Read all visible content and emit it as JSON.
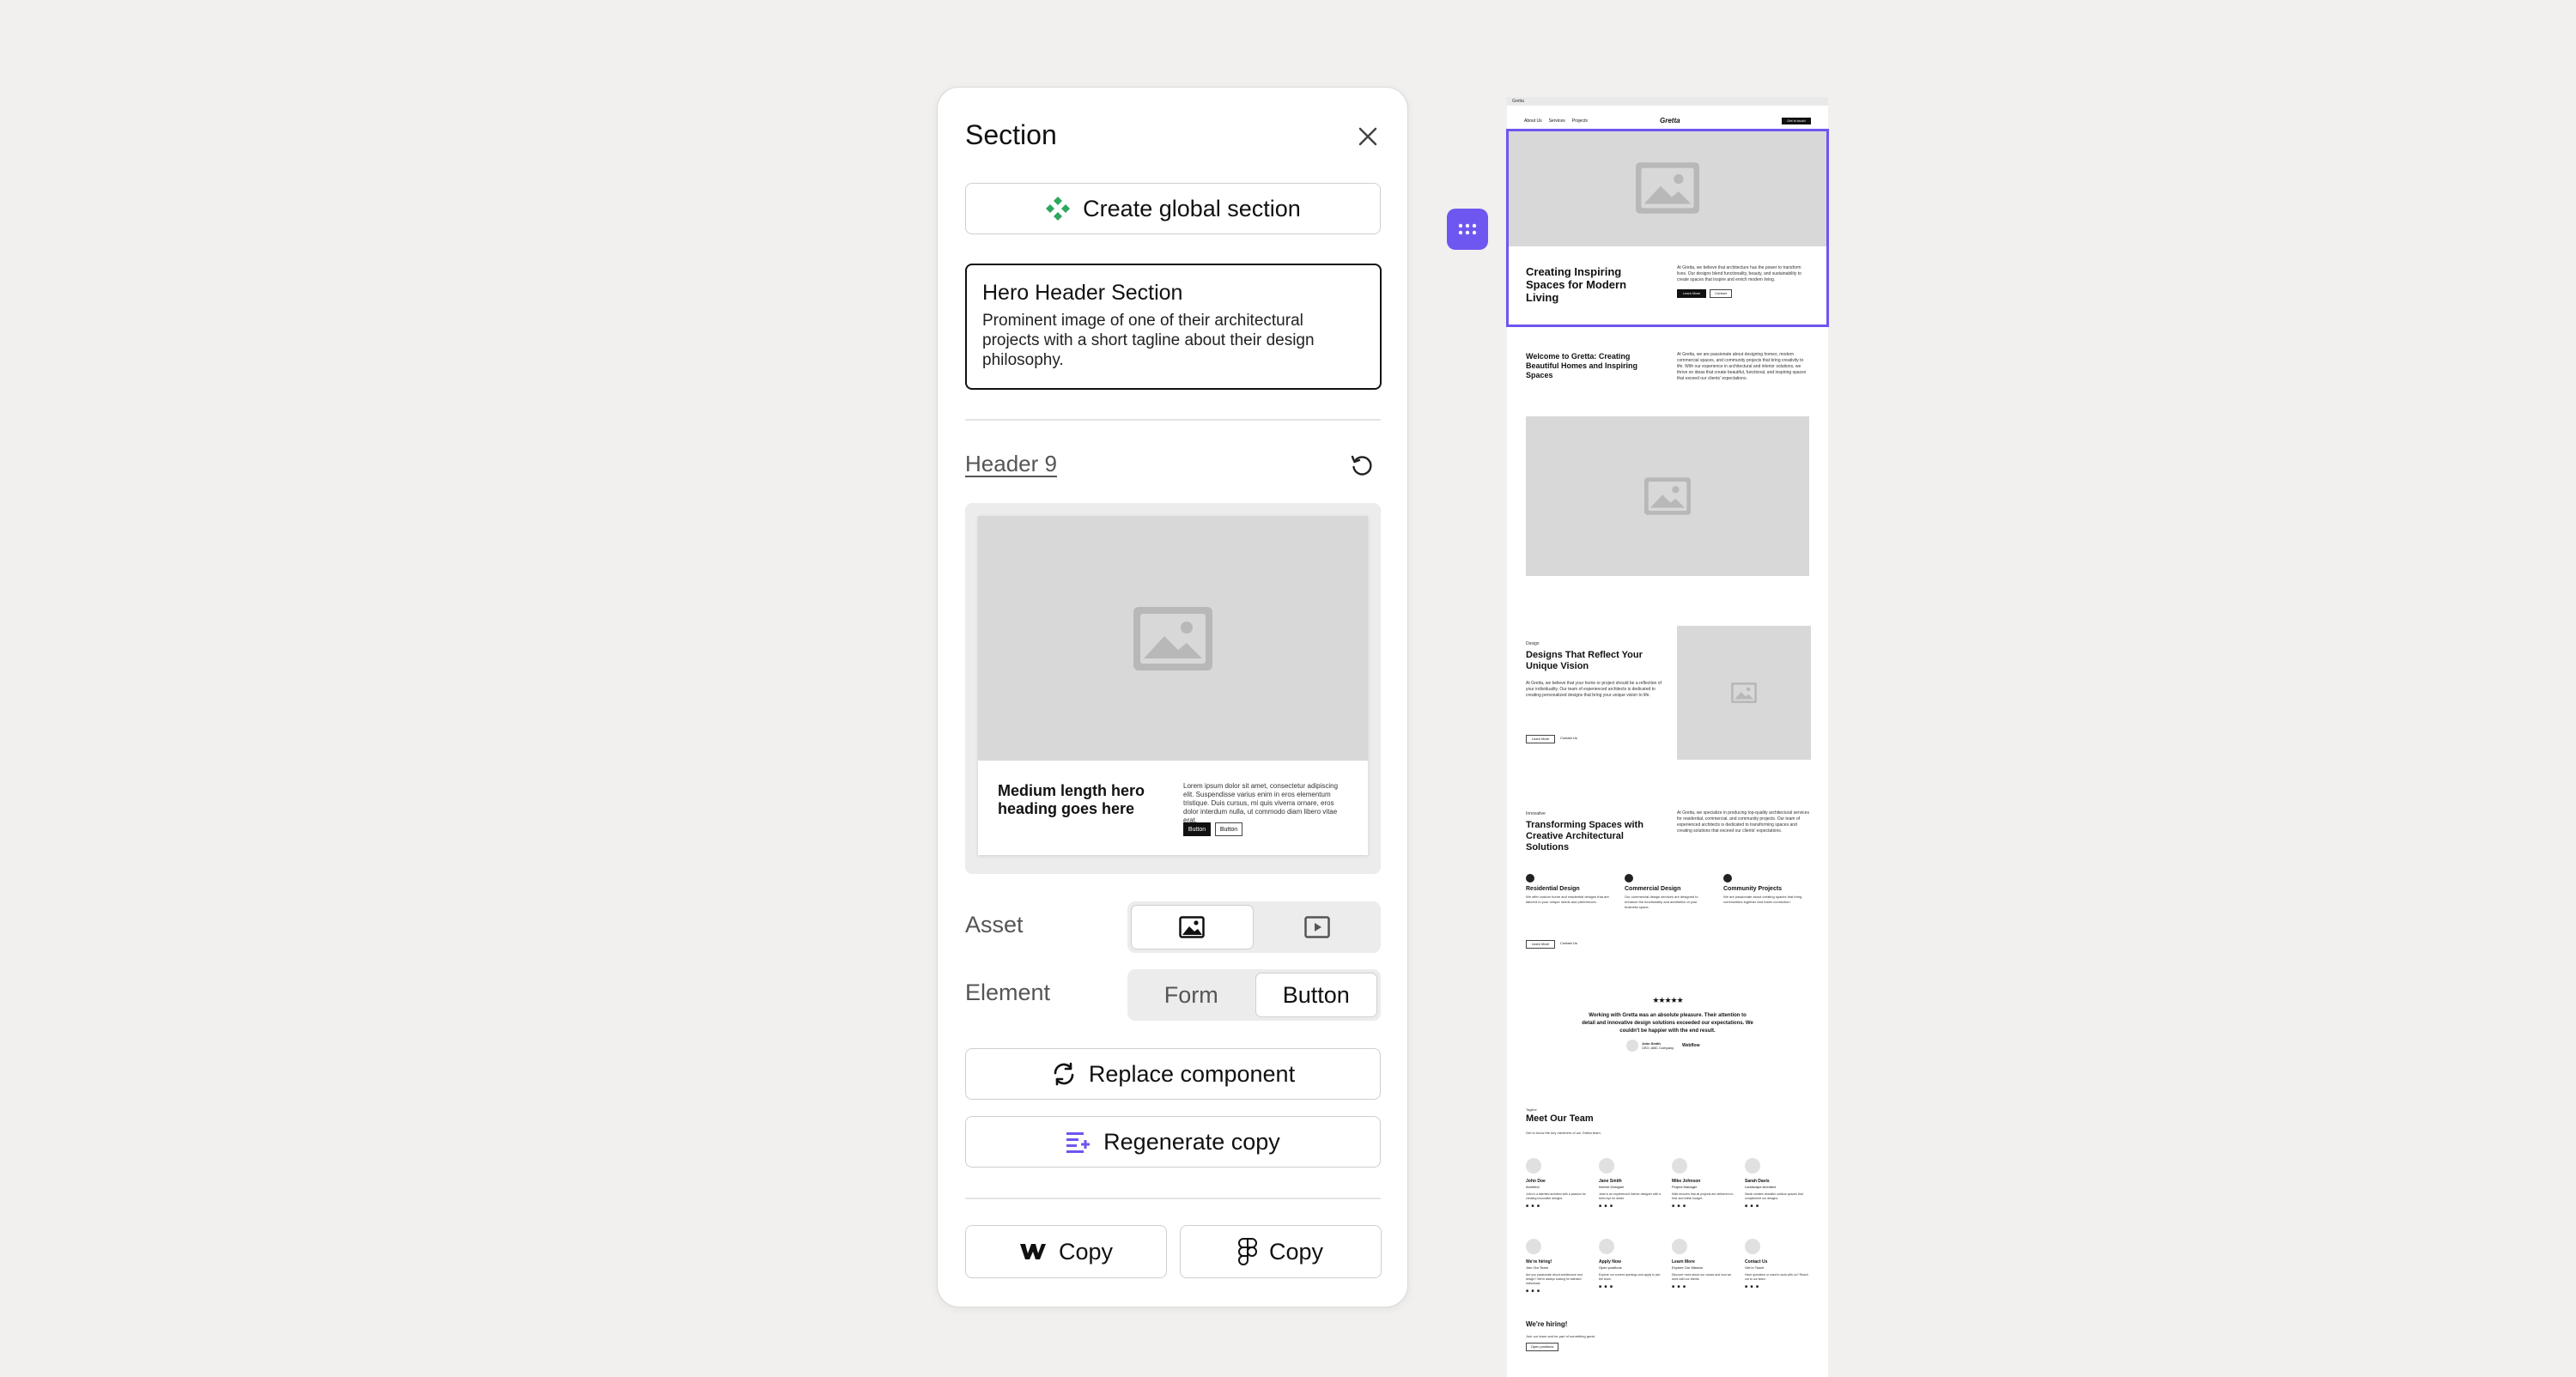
{
  "panel": {
    "title": "Section",
    "global_button_label": "Create global section",
    "section_name": "Hero Header Section",
    "section_description": "Prominent image of one of their architectural projects with a short tagline about their design philosophy.",
    "component_name": "Header 9",
    "preview": {
      "heading": "Medium length hero heading goes here",
      "paragraph": "Lorem ipsum dolor sit amet, consectetur adipiscing elit. Suspendisse varius enim in eros elementum tristique. Duis cursus, mi quis viverra ornare, eros dolor interdum nulla, ut commodo diam libero vitae erat.",
      "primary_button": "Button",
      "secondary_button": "Button"
    },
    "asset_label": "Asset",
    "element_label": "Element",
    "element_options": [
      "Form",
      "Button"
    ],
    "replace_label": "Replace component",
    "regenerate_label": "Regenerate copy",
    "copy_webflow_label": "Copy",
    "copy_figma_label": "Copy"
  },
  "site": {
    "browser_tab": "Gretta",
    "logo": "Gretta",
    "nav": [
      "About Us",
      "Services",
      "Projects"
    ],
    "nav_cta": "Get in touch",
    "hero": {
      "heading": "Creating Inspiring Spaces for Modern Living",
      "text": "At Gretta, we believe that architecture has the power to transform lives. Our designs blend functionality, beauty, and sustainability to create spaces that inspire and enrich modern living.",
      "primary": "Learn More",
      "secondary": "Contact"
    },
    "welcome": {
      "heading": "Welcome to Gretta: Creating Beautiful Homes and Inspiring Spaces",
      "text": "At Gretta, we are passionate about designing homes, modern commercial spaces, and community projects that bring creativity to life. With our experience in architectural and interior solutions, we thrive on ideas that create beautiful, functional, and inspiring spaces that exceed our clients' expectations."
    },
    "vision": {
      "tag": "Design",
      "heading": "Designs That Reflect Your Unique Vision",
      "text": "At Gretta, we believe that your home or project should be a reflection of your individuality. Our team of experienced architects is dedicated to creating personalized designs that bring your unique vision to life.",
      "primary": "Learn More",
      "secondary": "Contact Us"
    },
    "transform": {
      "tag": "Innovative",
      "heading": "Transforming Spaces with Creative Architectural Solutions",
      "text": "At Gretta, we specialize in producing top-quality architectural services for residential, commercial, and community projects. Our team of experienced architects is dedicated to transforming spaces and creating solutions that exceed our clients' expectations.",
      "features": [
        {
          "title": "Residential Design",
          "text": "We offer custom home and residential designs that are tailored to your unique needs and preferences."
        },
        {
          "title": "Commercial Design",
          "text": "Our commercial design services are designed to enhance the functionality and aesthetics of your business space."
        },
        {
          "title": "Community Projects",
          "text": "We are passionate about creating spaces that bring communities together and foster connection."
        }
      ],
      "primary": "Learn More",
      "secondary": "Contact Us"
    },
    "testimonial": {
      "stars": "★★★★★",
      "quote": "Working with Gretta was an absolute pleasure. Their attention to detail and innovative design solutions exceeded our expectations. We couldn't be happier with the end result.",
      "name": "John Smith",
      "role": "CEO, ABC Company",
      "company": "Webflow"
    },
    "team": {
      "tag": "Tagline",
      "heading": "Meet Our Team",
      "subheading": "Get to know the key members of our Gretta team.",
      "members": [
        {
          "name": "John Doe",
          "role": "Architect",
          "bio": "John is a talented architect with a passion for creating innovative designs."
        },
        {
          "name": "Jane Smith",
          "role": "Interior Designer",
          "bio": "Jane is an experienced interior designer with a keen eye for detail."
        },
        {
          "name": "Mike Johnson",
          "role": "Project Manager",
          "bio": "Mike ensures that all projects are delivered on time and within budget."
        },
        {
          "name": "Sarah Davis",
          "role": "Landscape Architect",
          "bio": "Sarah creates beautiful outdoor spaces that complement our designs."
        },
        {
          "name": "We're hiring!",
          "role": "Join Our Team",
          "bio": "Are you passionate about architecture and design? We're always looking for talented individuals."
        },
        {
          "name": "Apply Now",
          "role": "Open positions",
          "bio": "Explore our current openings and apply to join the team."
        },
        {
          "name": "Learn More",
          "role": "Explore Our Mission",
          "bio": "Discover more about our values and how we work with our clients."
        },
        {
          "name": "Contact Us",
          "role": "Get in Touch",
          "bio": "Have questions or want to work with us? Reach out to our team."
        }
      ],
      "hiring_heading": "We're hiring!",
      "hiring_text": "Join our team and be part of something great.",
      "hiring_button": "Open positions"
    }
  },
  "colors": {
    "accent": "#6e56f0",
    "placeholder": "#d8d8d8",
    "green_icon": "#2fa85f"
  }
}
